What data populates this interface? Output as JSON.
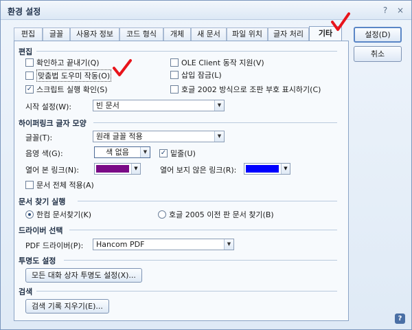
{
  "window": {
    "title": "환경 설정",
    "help_glyph": "?",
    "close_glyph": "×"
  },
  "tabs": [
    {
      "label": "편집"
    },
    {
      "label": "글꼴"
    },
    {
      "label": "사용자 정보"
    },
    {
      "label": "코드 형식"
    },
    {
      "label": "개체"
    },
    {
      "label": "새 문서"
    },
    {
      "label": "파일 위치"
    },
    {
      "label": "글자 처리"
    },
    {
      "label": "기타",
      "active": true
    }
  ],
  "buttons": {
    "ok": "설정(D)",
    "cancel": "취소"
  },
  "edit": {
    "title": "편집",
    "options": [
      {
        "label": "확인하고 끝내기(Q)",
        "checked": false
      },
      {
        "label": "맞춤법 도우미 작동(O)",
        "checked": false
      },
      {
        "label": "스크립트 실행 확인(S)",
        "checked": true
      },
      {
        "label": "OLE Client 동작 지원(V)",
        "checked": false
      },
      {
        "label": "삽입 잠금(L)",
        "checked": false
      },
      {
        "label": "호글 2002 방식으로 조판 부호 표시하기(C)",
        "checked": false
      }
    ],
    "start_label": "시작 설정(W):",
    "start_value": "빈 문서"
  },
  "hyperlink": {
    "title": "하이퍼링크 글자 모양",
    "font_label": "글꼴(T):",
    "font_value": "원래 글꼴 적용",
    "shade_label": "음영 색(G):",
    "shade_value": "색 없음",
    "underline_label": "밑줄(U)",
    "underline_checked": true,
    "visited_label": "열어 본 링크(N):",
    "visited_color": "#7a0a86",
    "unvisited_label": "열어 보지 않은 링크(R):",
    "unvisited_color": "#0000ff",
    "whole_doc_label": "문서 전체 적용(A)",
    "whole_doc_checked": false
  },
  "find": {
    "title": "문서 찾기 실행",
    "opt1": "한컴 문서찾기(K)",
    "opt2": "호글 2005 이전 판 문서 찾기(B)",
    "selected": 1
  },
  "driver": {
    "title": "드라이버 선택",
    "label": "PDF 드라이버(P):",
    "value": "Hancom PDF"
  },
  "transparency": {
    "title": "투명도 설정",
    "button": "모든 대화 상자 투명도 설정(X)..."
  },
  "search": {
    "title": "검색",
    "button": "검색 기록 지우기(E)..."
  },
  "colors": {
    "annotation_red": "#e8141b",
    "accent": "#5a86c6"
  }
}
